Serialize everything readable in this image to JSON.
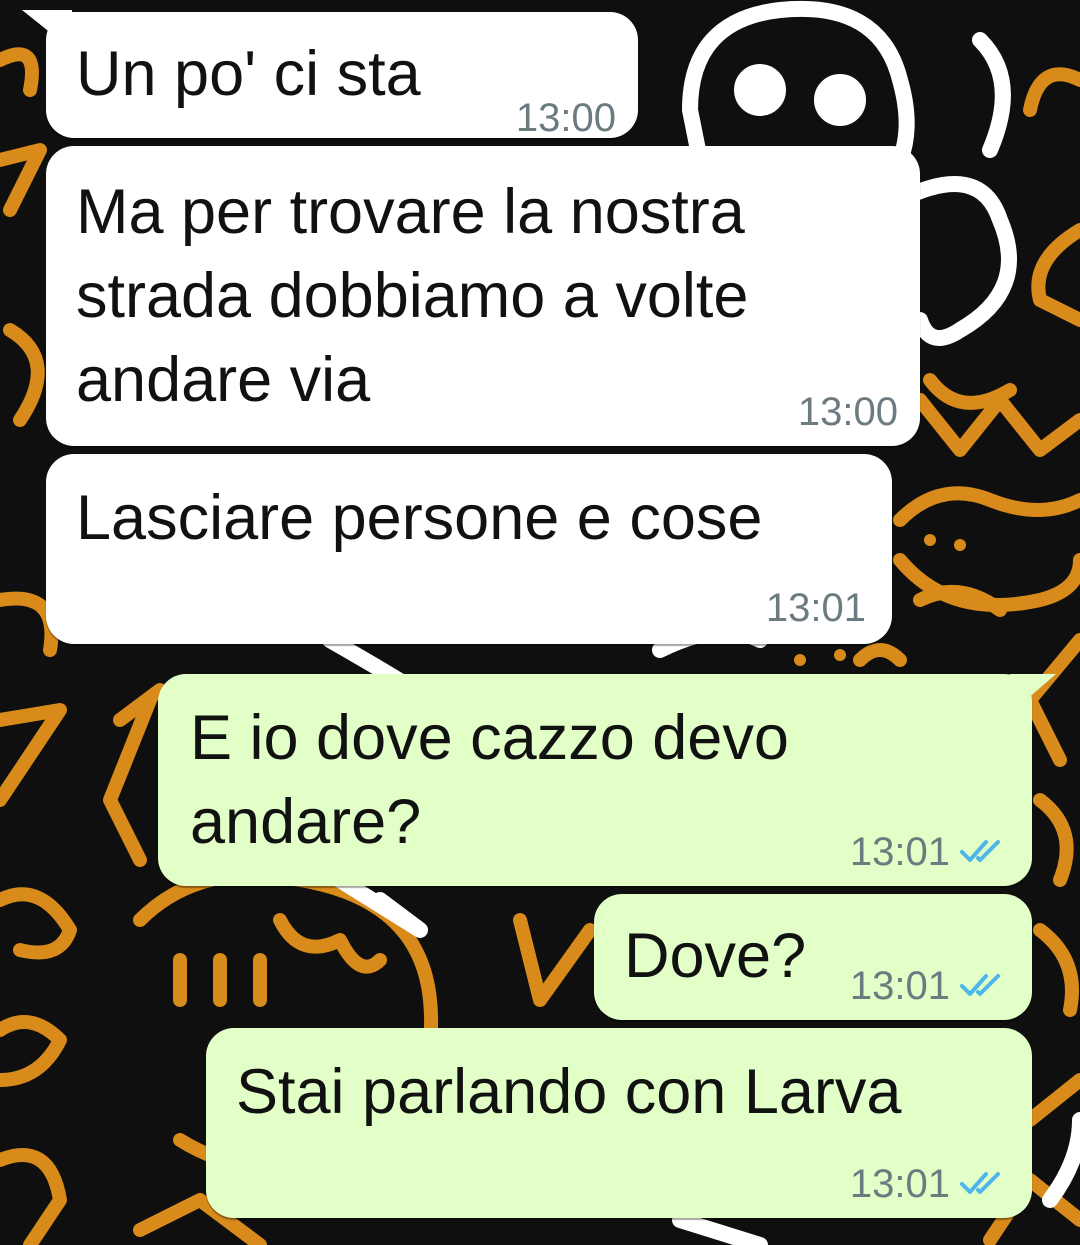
{
  "chat": {
    "messages": [
      {
        "direction": "incoming",
        "text": "Un po' ci sta",
        "time": "13:00"
      },
      {
        "direction": "incoming",
        "lines": [
          "Ma per trovare la nostra",
          "strada dobbiamo a volte",
          "andare via"
        ],
        "time": "13:00"
      },
      {
        "direction": "incoming",
        "text": "Lasciare persone e cose",
        "time": "13:01"
      },
      {
        "direction": "outgoing",
        "lines": [
          "E io dove cazzo devo",
          "andare?"
        ],
        "time": "13:01",
        "status": "read"
      },
      {
        "direction": "outgoing",
        "text": "Dove?",
        "time": "13:01",
        "status": "read"
      },
      {
        "direction": "outgoing",
        "text": "Stai parlando con Larva",
        "time": "13:01",
        "status": "read"
      }
    ]
  },
  "colors": {
    "incoming_bubble": "#ffffff",
    "outgoing_bubble": "#e2ffc7",
    "wallpaper_bg": "#0f0f0f",
    "doodle_orange": "#d88a1a",
    "doodle_white": "#ffffff",
    "read_ticks": "#4fb6ec",
    "timestamp": "#6b7b80"
  },
  "icons": {
    "read_receipt": "double-check-icon"
  }
}
